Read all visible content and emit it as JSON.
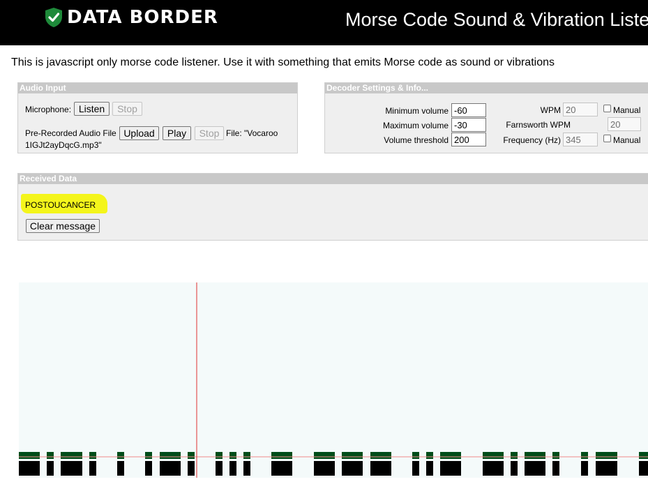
{
  "header": {
    "logo_text": "DATA BORDER",
    "page_title": "Morse Code Sound & Vibration Listener"
  },
  "intro_text": "This is javascript only morse code listener. Use it with something that emits Morse code as sound or vibrations",
  "audio_input": {
    "title": "Audio Input",
    "microphone_label": "Microphone:",
    "listen_label": "Listen",
    "stop_label": "Stop",
    "prerecorded_label": "Pre-Recorded Audio File",
    "upload_label": "Upload",
    "play_label": "Play",
    "file_line1": "File: \"Vocaroo",
    "file_line2": "1IGJt2ayDqcG.mp3\""
  },
  "decoder": {
    "title": "Decoder Settings & Info...",
    "min_volume_label": "Minimum volume",
    "min_volume_value": "-60",
    "max_volume_label": "Maximum volume",
    "max_volume_value": "-30",
    "threshold_label": "Volume threshold",
    "threshold_value": "200",
    "wpm_label": "WPM",
    "wpm_value": "20",
    "farnsworth_label": "Farnsworth WPM",
    "farnsworth_value": "20",
    "frequency_label": "Frequency (Hz)",
    "frequency_value": "345",
    "manual_label": "Manual"
  },
  "received": {
    "title": "Received Data",
    "message": "POSTOUCANCER",
    "clear_label": "Clear message"
  },
  "colors": {
    "signal_green": "#004d1a",
    "cursor_red": "#e03030",
    "highlight": "#f4f51b",
    "logo_green": "#1e8a3a"
  }
}
